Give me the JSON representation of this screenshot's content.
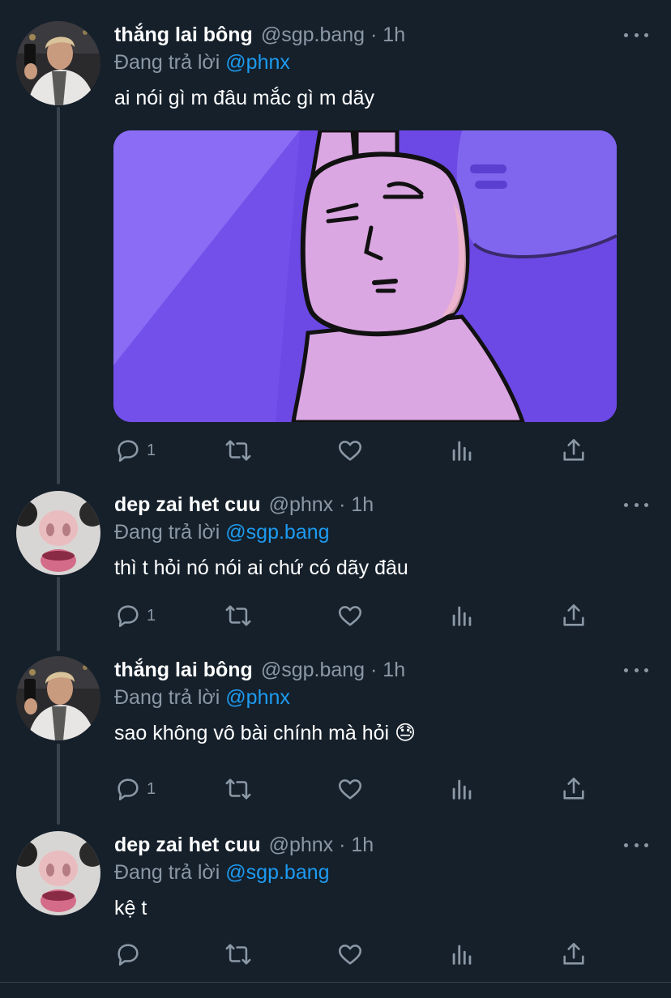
{
  "colors": {
    "background": "#15202b",
    "text": "#ffffff",
    "secondary": "#8b98a5",
    "link": "#1d9bf0"
  },
  "tweets": [
    {
      "name": "thắng lai bông",
      "handle": "@sgp.bang · 1h",
      "replying_prefix": "Đang trả lời ",
      "replying_to": "@phnx",
      "text": "ai nói gì m đâu mắc gì m dãy",
      "reply_count": "1",
      "has_media": true
    },
    {
      "name": "dep zai het cuu",
      "handle": "@phnx · 1h",
      "replying_prefix": "Đang trả lời ",
      "replying_to": "@sgp.bang",
      "text": "thì t hỏi nó nói ai chứ có dãy đâu",
      "reply_count": "1"
    },
    {
      "name": "thắng lai bông",
      "handle": "@sgp.bang · 1h",
      "replying_prefix": "Đang trả lời ",
      "replying_to": "@phnx",
      "text": "sao không vô bài chính mà hỏi 😓",
      "reply_count": "1"
    },
    {
      "name": "dep zai het cuu",
      "handle": "@phnx · 1h",
      "replying_prefix": "Đang trả lời ",
      "replying_to": "@sgp.bang",
      "text": "kệ t",
      "reply_count": ""
    }
  ],
  "icons": [
    "reply-icon",
    "retweet-icon",
    "like-icon",
    "analytics-icon",
    "share-icon",
    "more-icon"
  ]
}
